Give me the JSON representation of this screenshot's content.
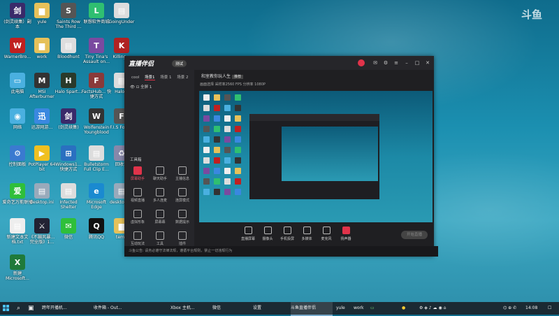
{
  "watermark": "斗鱼",
  "desktop_icons": [
    {
      "label": "(剑灵续集）副本",
      "color": "#3a2a6a",
      "glyph": "剑"
    },
    {
      "label": "yule",
      "color": "#e6c15a",
      "glyph": "▆"
    },
    {
      "label": "Saints Row The Third ...",
      "color": "#555",
      "glyph": "S"
    },
    {
      "label": "联想软件商城",
      "color": "#2fbf71",
      "glyph": "L"
    },
    {
      "label": "GoingUnder",
      "color": "#ddd",
      "glyph": "▤"
    },
    {
      "label": "WarnerBro...",
      "color": "#c02020",
      "glyph": "W"
    },
    {
      "label": "work",
      "color": "#e6c15a",
      "glyph": "▆"
    },
    {
      "label": "Bloodhunt",
      "color": "#ddd",
      "glyph": "▤"
    },
    {
      "label": "Tiny Tina's Assault on...",
      "color": "#7a4aa0",
      "glyph": "T"
    },
    {
      "label": "Killing...",
      "color": "#b02222",
      "glyph": "K"
    },
    {
      "label": "此电脑",
      "color": "#4ab0e0",
      "glyph": "▭"
    },
    {
      "label": "MSI Afterburner",
      "color": "#333",
      "glyph": "M"
    },
    {
      "label": "Halo Spart...",
      "color": "#2a3a2a",
      "glyph": "H"
    },
    {
      "label": "FactsHub... 快捷方式",
      "color": "#8a3a3a",
      "glyph": "F"
    },
    {
      "label": "Halo...",
      "color": "#ddd",
      "glyph": "▤"
    },
    {
      "label": "网络",
      "color": "#4ab0e0",
      "glyph": "◉"
    },
    {
      "label": "迅游网游...",
      "color": "#3a88e0",
      "glyph": "迅"
    },
    {
      "label": "(剑灵续集)",
      "color": "#3a2a6a",
      "glyph": "剑"
    },
    {
      "label": "Wolfenstein Youngblood",
      "color": "#333",
      "glyph": "W"
    },
    {
      "label": "F.I.S Forg...",
      "color": "#555",
      "glyph": "F"
    },
    {
      "label": "控制面板",
      "color": "#3a7ad0",
      "glyph": "⚙"
    },
    {
      "label": "PotPlayer 64 bit",
      "color": "#f0c020",
      "glyph": "▶"
    },
    {
      "label": "Windows1... 快捷方式",
      "color": "#2a70c0",
      "glyph": "⊞"
    },
    {
      "label": "Bulletstorm Full Clip E...",
      "color": "#ddd",
      "glyph": "▤"
    },
    {
      "label": "回收站",
      "color": "#88a",
      "glyph": "♻"
    },
    {
      "label": "爱奇艺万能联播",
      "color": "#2fbf3a",
      "glyph": "爱"
    },
    {
      "label": "desktop.ini",
      "color": "#9ab",
      "glyph": "▤"
    },
    {
      "label": "Infected Shelter",
      "color": "#ddd",
      "glyph": "▤"
    },
    {
      "label": "Microsoft Edge",
      "color": "#1a8ad0",
      "glyph": "e"
    },
    {
      "label": "desktop.ini",
      "color": "#9ab",
      "glyph": "▤"
    },
    {
      "label": "新建文本文档.txt",
      "color": "#eee",
      "glyph": "▤"
    },
    {
      "label": "《不蹦风暴... 完全版》1...",
      "color": "#223",
      "glyph": "⚔"
    },
    {
      "label": "微信",
      "color": "#2fbf3a",
      "glyph": "✉"
    },
    {
      "label": "腾讯QQ",
      "color": "#111",
      "glyph": "Q"
    },
    {
      "label": "temp",
      "color": "#e6c15a",
      "glyph": "▆"
    },
    {
      "label": "新建 Microsoft...",
      "color": "#1f7a3a",
      "glyph": "X"
    }
  ],
  "app": {
    "logo": "直播伴侣",
    "version": "测试",
    "scene_tabs": [
      "cool",
      "场景1",
      "场景 1",
      "场景 2"
    ],
    "main_title": "和室教你玩人生",
    "main_tag": "推荐",
    "main_sub": "画面选择  采样率2560 FPS  分辨率 1080P",
    "layer_label": "全屏 1",
    "tools_title": "工具箱",
    "tools": [
      "屏幕助手",
      "聊天助手",
      "主播信息",
      "视频直播",
      "多人连麦",
      "连屏模式",
      "虚拟形象",
      "屏幕幕",
      "数据提示",
      "互动玩法",
      "工具",
      "插件"
    ],
    "controls": [
      "直播屏幕",
      "摄像头",
      "手机投屏",
      "多媒体",
      "麦克风",
      "扬声器"
    ],
    "go_live": "开始直播",
    "footer": "斗鱼公告: 请务必遵守法律法规，遵循平台规则，禁止一切违规行为"
  },
  "taskbar": {
    "items": [
      "跨年开播机...",
      "收件箱 - Out...",
      "Xbox 主机...",
      "微信",
      "设置",
      "斗鱼直播伴侣"
    ],
    "tray_labels": [
      "yule",
      "work"
    ],
    "time": "14:08"
  }
}
